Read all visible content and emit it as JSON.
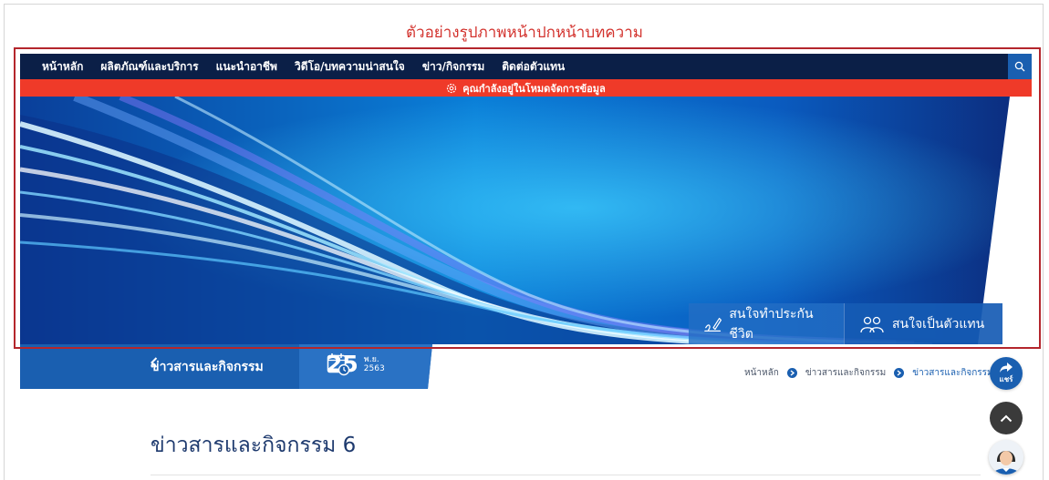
{
  "caption": "ตัวอย่างรูปภาพหน้าปกหน้าบทความ",
  "nav": {
    "items": [
      {
        "label": "หน้าหลัก"
      },
      {
        "label": "ผลิตภัณฑ์และบริการ"
      },
      {
        "label": "แนะนำอาชีพ"
      },
      {
        "label": "วิดีโอ/บทความน่าสนใจ"
      },
      {
        "label": "ข่าว/กิจกรรม"
      },
      {
        "label": "ติดต่อตัวแทน"
      }
    ],
    "search_icon": "search-icon"
  },
  "alert": {
    "text": "คุณกำลังอยู่ในโหมดจัดการข้อมูล",
    "icon": "gear-icon"
  },
  "cta": {
    "life_label": "สนใจทำประกันชีวิต",
    "agent_label": "สนใจเป็นตัวแทน"
  },
  "sub_header": {
    "back_label": "ข่าวสารและกิจกรรม",
    "date_day": "25",
    "date_month": "พ.ย.",
    "date_year": "2563"
  },
  "breadcrumb": {
    "items": [
      {
        "label": "หน้าหลัก"
      },
      {
        "label": "ข่าวสารและกิจกรรม"
      },
      {
        "label": "ข่าวสารและกิจกรรม 6"
      }
    ]
  },
  "share": {
    "label": "แชร์"
  },
  "article": {
    "title": "ข่าวสารและกิจกรรม 6"
  },
  "colors": {
    "nav_bg": "#0b1f47",
    "alert_bg": "#ef3a29",
    "brand_blue": "#1a5fb0",
    "caption_red": "#d3332e",
    "title_navy": "#1e3a6e"
  }
}
